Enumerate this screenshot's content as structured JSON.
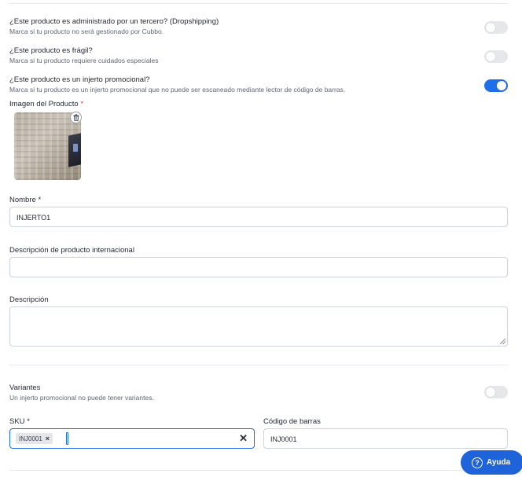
{
  "toggles": [
    {
      "title": "¿Este producto es administrado por un tercero? (Dropshipping)",
      "desc": "Marca si tu producto no será gestionado por Cubbo.",
      "state": "off"
    },
    {
      "title": "¿Este producto es frágil?",
      "desc": "Marca si tu producto requiere cuidados especiales",
      "state": "off"
    },
    {
      "title": "¿Este producto es un injerto promocional?",
      "desc": "Marca si tu producto es un injerto promocional que no puede ser escaneado mediante lector de código de barras.",
      "state": "on"
    }
  ],
  "image": {
    "label": "Imagen del Producto",
    "required_mark": "*",
    "delete_icon": "trash-icon"
  },
  "nombre": {
    "label": "Nombre",
    "required_mark": "*",
    "value": "INJERTO1"
  },
  "descripcion_internacional": {
    "label": "Descripción de producto internacional",
    "value": ""
  },
  "descripcion": {
    "label": "Descripción",
    "value": ""
  },
  "variantes": {
    "title": "Variantes",
    "desc": "Un injerto promocional no puede tener variantes.",
    "state": "off"
  },
  "sku": {
    "label": "SKU",
    "required_mark": "*",
    "chip": "INJ0001",
    "chip_remove": "×",
    "clear": "✕"
  },
  "codigo_barras": {
    "label": "Código de barras",
    "value": "INJ0001"
  },
  "help": {
    "label": "Ayuda",
    "icon": "?"
  },
  "colors": {
    "accent": "#1f6feb",
    "help_bg": "#1f63db",
    "required": "#e53935"
  }
}
